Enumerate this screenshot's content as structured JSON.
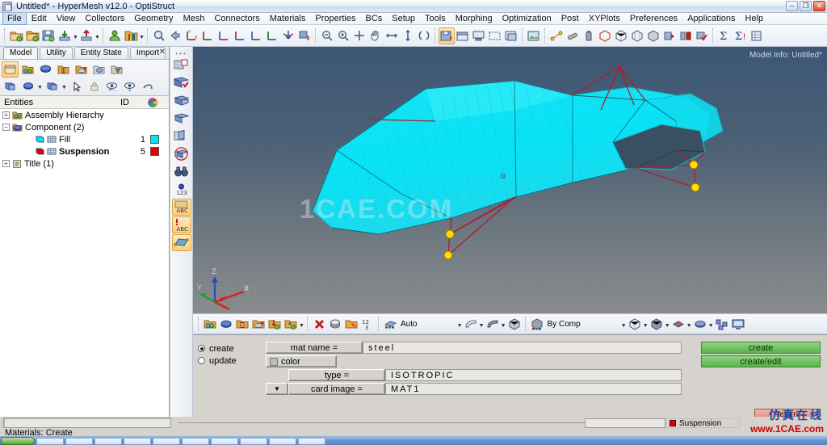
{
  "window": {
    "title": "Untitled* - HyperMesh v12.0 - OptiStruct",
    "icon": "hypermesh-icon",
    "buttons": {
      "minimize": "–",
      "maximize": "❐",
      "close": "✕"
    }
  },
  "menu": {
    "items": [
      "File",
      "Edit",
      "View",
      "Collectors",
      "Geometry",
      "Mesh",
      "Connectors",
      "Materials",
      "Properties",
      "BCs",
      "Setup",
      "Tools",
      "Morphing",
      "Optimization",
      "Post",
      "XYPlots",
      "Preferences",
      "Applications",
      "Help"
    ],
    "active": "File"
  },
  "browser": {
    "tabs": [
      "Model",
      "Utility",
      "Entity State",
      "Import"
    ],
    "active_tab": "Model",
    "close_label": "✕",
    "tree_header": {
      "entities": "Entities",
      "id": "ID",
      "color_icon": "color-wheel-icon"
    },
    "tree": [
      {
        "label": "Assembly Hierarchy",
        "id": "",
        "color": "",
        "expander": "+",
        "indent": 1,
        "bold": false,
        "icon": "assembly-icon"
      },
      {
        "label": "Component (2)",
        "id": "",
        "color": "",
        "expander": "−",
        "indent": 1,
        "bold": false,
        "icon": "component-folder-icon"
      },
      {
        "label": "Fill",
        "id": "1",
        "color": "#00e5f0",
        "expander": "",
        "indent": 3,
        "bold": false,
        "icon": "mesh-icon"
      },
      {
        "label": "Suspension",
        "id": "5",
        "color": "#e00000",
        "expander": "",
        "indent": 3,
        "bold": true,
        "icon": "mesh-icon"
      },
      {
        "label": "Title (1)",
        "id": "",
        "color": "",
        "expander": "+",
        "indent": 1,
        "bold": false,
        "icon": "title-icon"
      }
    ]
  },
  "viewport": {
    "model_info": "Model Info: Untitled*",
    "watermark": "1CAE.COM",
    "axes": {
      "x": "X",
      "y": "Y",
      "z": "Z"
    },
    "mesh_color": "#00e8f5",
    "connector_color": "#b01c2e",
    "node_color": "#ffe000"
  },
  "panel_toolbar": {
    "auto_label": "Auto",
    "by_comp_label": "By Comp"
  },
  "panel": {
    "mode_options": [
      {
        "label": "create",
        "selected": true
      },
      {
        "label": "update",
        "selected": false
      }
    ],
    "fields": [
      {
        "label": "mat name =",
        "value": "steel",
        "spaced": true
      },
      {
        "label": "color",
        "value": "",
        "kind": "color",
        "swatch": "#bdbdbd"
      },
      {
        "label": "type =",
        "value": "ISOTROPIC",
        "spaced": true
      },
      {
        "label": "card image =",
        "value": "MAT1",
        "spaced": true,
        "dropdown": "▼"
      }
    ],
    "actions": [
      "create",
      "create/edit"
    ],
    "return_label": "return"
  },
  "status": {
    "message": "Materials: Create",
    "active_component": "Suspension",
    "active_component_color": "#e00000",
    "command_value": ""
  },
  "brand": {
    "cn_text": "仿真在线",
    "url": "www.1CAE.com"
  }
}
